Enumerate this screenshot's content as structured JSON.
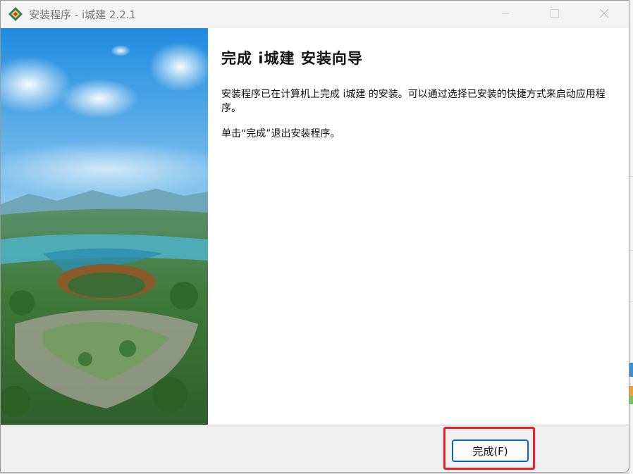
{
  "window": {
    "title": "安装程序 - i城建 2.2.1",
    "icon": "app-logo-icon",
    "controls": [
      "minimize-icon",
      "maximize-icon",
      "close-icon"
    ]
  },
  "main": {
    "heading": "完成 i城建 安装向导",
    "paragraphs": [
      "安装程序已在计算机上完成 i城建 的安装。可以通过选择已安装的快捷方式来启动应用程序。",
      "单击“完成”退出安装程序。"
    ],
    "side_image": "landscape-illustration"
  },
  "footer": {
    "finish_label": "完成(F)"
  },
  "colors": {
    "accent": "#0067c0",
    "highlight": "#e8202a"
  }
}
